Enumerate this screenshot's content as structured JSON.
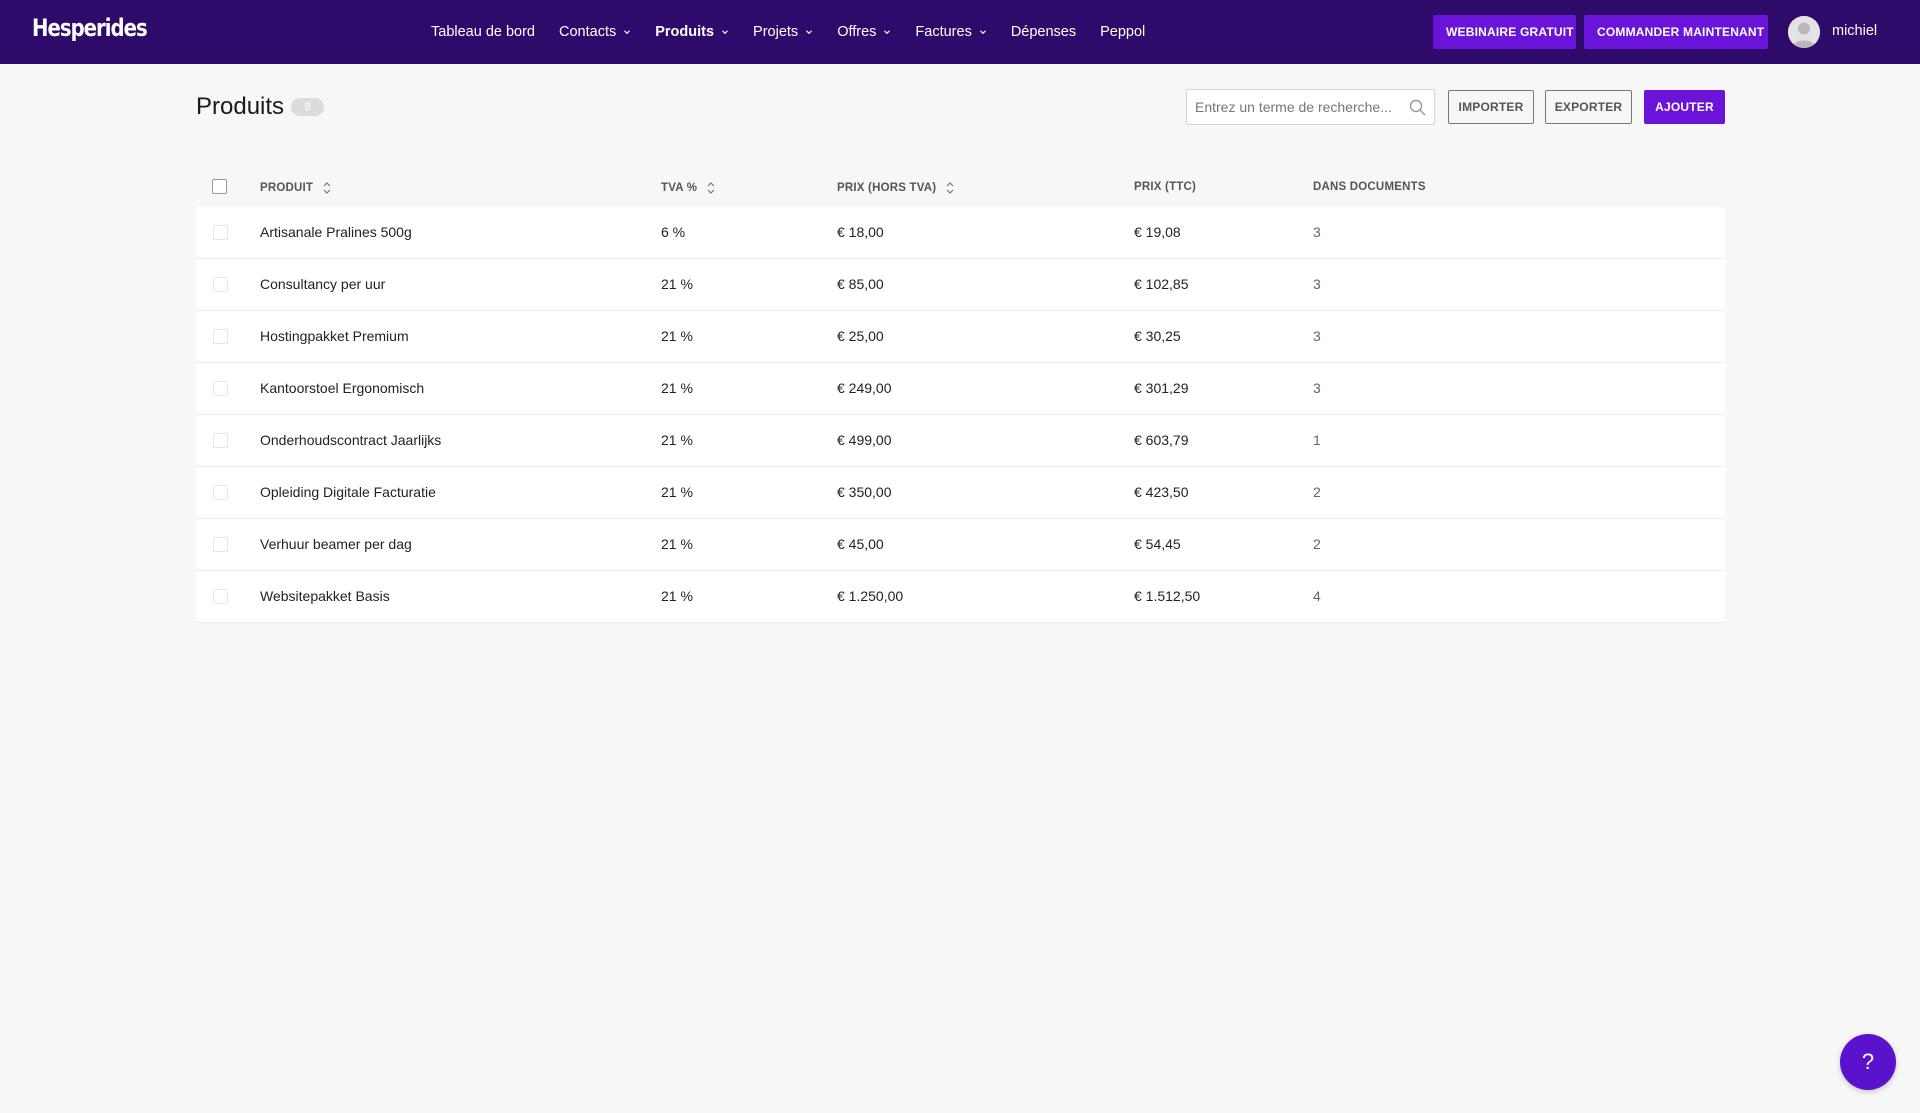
{
  "app": {
    "logo": "Hesperides"
  },
  "nav": {
    "items": [
      {
        "label": "Tableau de bord",
        "dropdown": false,
        "active": false
      },
      {
        "label": "Contacts",
        "dropdown": true,
        "active": false
      },
      {
        "label": "Produits",
        "dropdown": true,
        "active": true
      },
      {
        "label": "Projets",
        "dropdown": true,
        "active": false
      },
      {
        "label": "Offres",
        "dropdown": true,
        "active": false
      },
      {
        "label": "Factures",
        "dropdown": true,
        "active": false
      },
      {
        "label": "Dépenses",
        "dropdown": false,
        "active": false
      },
      {
        "label": "Peppol",
        "dropdown": false,
        "active": false
      }
    ],
    "webinar_label": "WEBINAIRE GRATUIT",
    "order_label": "COMMANDER MAINTENANT",
    "username": "michiel"
  },
  "page": {
    "title": "Produits",
    "count": "8",
    "search_placeholder": "Entrez un terme de recherche...",
    "import_label": "IMPORTER",
    "export_label": "EXPORTER",
    "add_label": "AJOUTER"
  },
  "table": {
    "headers": {
      "product": "PRODUIT",
      "tva": "TVA %",
      "price_ht": "PRIX (HORS TVA)",
      "price_ttc": "PRIX (TTC)",
      "docs": "DANS DOCUMENTS"
    },
    "rows": [
      {
        "name": "Artisanale Pralines 500g",
        "tva": "6 %",
        "ht": "€ 18,00",
        "ttc": "€ 19,08",
        "docs": "3"
      },
      {
        "name": "Consultancy per uur",
        "tva": "21 %",
        "ht": "€ 85,00",
        "ttc": "€ 102,85",
        "docs": "3"
      },
      {
        "name": "Hostingpakket Premium",
        "tva": "21 %",
        "ht": "€ 25,00",
        "ttc": "€ 30,25",
        "docs": "3"
      },
      {
        "name": "Kantoorstoel Ergonomisch",
        "tva": "21 %",
        "ht": "€ 249,00",
        "ttc": "€ 301,29",
        "docs": "3"
      },
      {
        "name": "Onderhoudscontract Jaarlijks",
        "tva": "21 %",
        "ht": "€ 499,00",
        "ttc": "€ 603,79",
        "docs": "1"
      },
      {
        "name": "Opleiding Digitale Facturatie",
        "tva": "21 %",
        "ht": "€ 350,00",
        "ttc": "€ 423,50",
        "docs": "2"
      },
      {
        "name": "Verhuur beamer per dag",
        "tva": "21 %",
        "ht": "€ 45,00",
        "ttc": "€ 54,45",
        "docs": "2"
      },
      {
        "name": "Websitepakket Basis",
        "tva": "21 %",
        "ht": "€ 1.250,00",
        "ttc": "€ 1.512,50",
        "docs": "4"
      }
    ]
  },
  "help": {
    "label": "?"
  },
  "colors": {
    "topbar": "#2e0a6b",
    "accent": "#6b14d9",
    "page_bg": "#f7f7f7"
  },
  "icons": {
    "search": "search-icon",
    "sort": "sort-icon",
    "chevron": "chevron-down-icon",
    "avatar": "user-avatar-icon"
  }
}
